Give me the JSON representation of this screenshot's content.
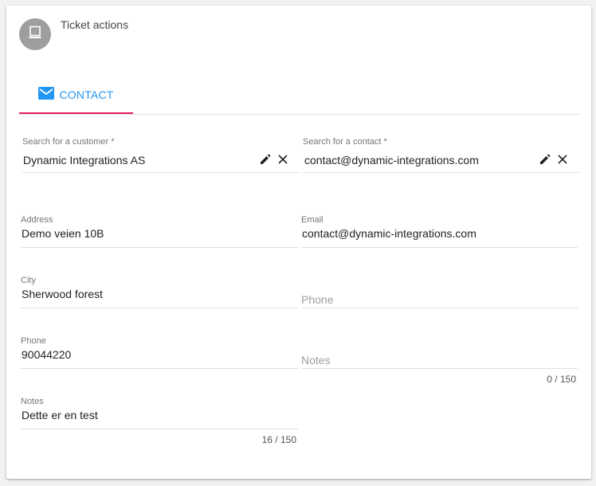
{
  "header": {
    "title": "Ticket actions",
    "avatar_icon": "computer-icon"
  },
  "tabs": [
    {
      "label": "CONTACT",
      "icon": "email-icon",
      "active": true
    }
  ],
  "colors": {
    "accent": "#2196f3",
    "tab_indicator": "#e91e63",
    "avatar_bg": "#9e9e9e"
  },
  "form": {
    "customer_search": {
      "label": "Search for a customer *",
      "value": "Dynamic Integrations AS"
    },
    "contact_search": {
      "label": "Search for a contact *",
      "value": "contact@dynamic-integrations.com"
    },
    "address": {
      "label": "Address",
      "value": "Demo veien 10B"
    },
    "email": {
      "label": "Email",
      "value": "contact@dynamic-integrations.com"
    },
    "city": {
      "label": "City",
      "value": "Sherwood forest"
    },
    "contact_phone": {
      "placeholder": "Phone"
    },
    "phone": {
      "label": "Phone",
      "value": "90044220"
    },
    "contact_notes": {
      "placeholder": "Notes",
      "counter": "0 / 150"
    },
    "notes": {
      "label": "Notes",
      "value": "Dette er en test",
      "counter": "16 / 150"
    }
  }
}
